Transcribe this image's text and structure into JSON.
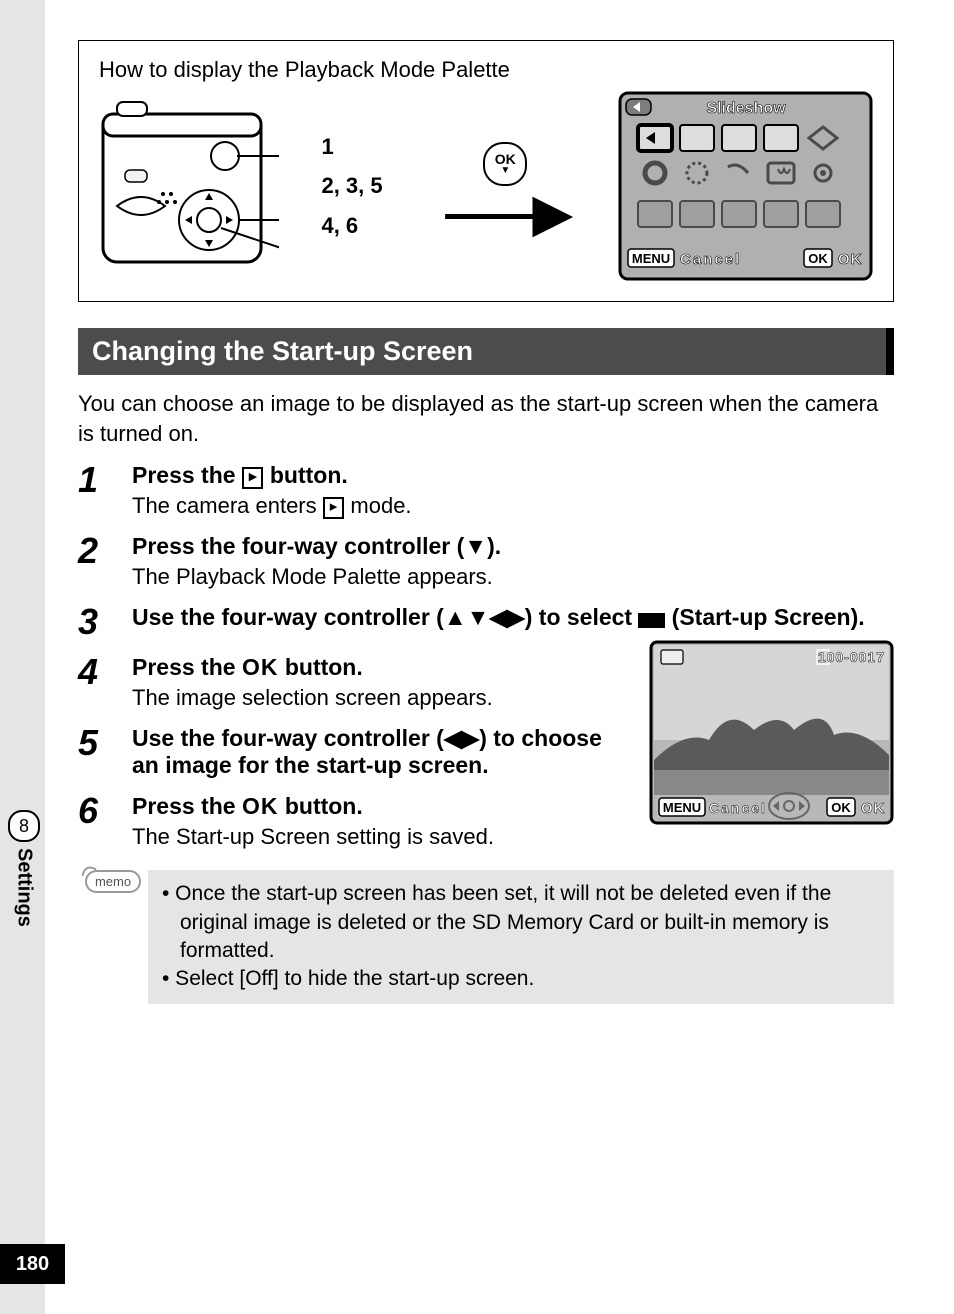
{
  "pageNumber": "180",
  "sideTab": {
    "chapter": "8",
    "label": "Settings"
  },
  "frameBox": {
    "title": "How to display the Playback Mode Palette",
    "labels": {
      "l1": "1",
      "l2": "2, 3, 5",
      "l3": "4, 6"
    },
    "ok": "OK",
    "screen": {
      "title": "Slideshow",
      "menuLabel": "MENU",
      "cancel": "Cancel",
      "okBox": "OK",
      "ok": "OK"
    }
  },
  "sectionHeader": "Changing the Start-up Screen",
  "intro": "You can choose an image to be displayed as the start-up screen when the camera is turned on.",
  "steps": {
    "s1": {
      "num": "1",
      "headA": "Press the ",
      "headB": " button.",
      "descA": "The camera enters ",
      "descB": " mode."
    },
    "s2": {
      "num": "2",
      "head": "Press the four-way controller (▼).",
      "desc": "The Playback Mode Palette appears."
    },
    "s3": {
      "num": "3",
      "headA": "Use the four-way controller (▲▼◀▶) to select ",
      "headB": " (Start-up Screen)."
    },
    "s4": {
      "num": "4",
      "headA": "Press the ",
      "ok": "OK",
      "headB": " button.",
      "desc": "The image selection screen appears."
    },
    "s5": {
      "num": "5",
      "head": "Use the four-way controller (◀▶) to choose an image for the start-up screen."
    },
    "s6": {
      "num": "6",
      "headA": "Press the ",
      "ok": "OK",
      "headB": " button.",
      "desc": "The Start-up Screen setting is saved."
    }
  },
  "preview": {
    "fileNumber": "100-0017",
    "menuLabel": "MENU",
    "cancel": "Cancel",
    "okBox": "OK",
    "ok": "OK"
  },
  "memo": {
    "label": "memo",
    "b1": "•  Once the start-up screen has been set, it will not be deleted even if the original image is deleted or the SD Memory Card or built-in memory is formatted.",
    "b2": "•  Select [Off] to hide the start-up screen."
  }
}
